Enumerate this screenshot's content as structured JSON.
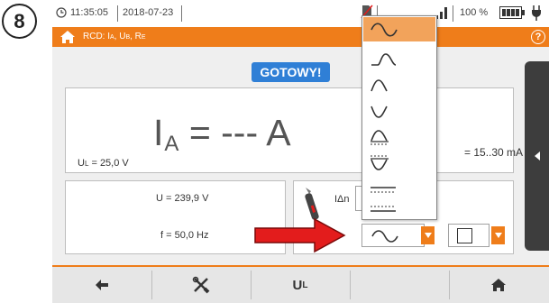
{
  "step_number": "8",
  "status": {
    "time": "11:35:05",
    "date": "2018-07-23",
    "battery_percent": "100 %",
    "icons": [
      "clock-icon",
      "sd-card-icon",
      "signal-bars-icon",
      "battery-icon",
      "plug-icon"
    ]
  },
  "titlebar": {
    "title": "RCD: I",
    "title_sub_a": "A",
    "title_mid": ", U",
    "title_sub_b": "B",
    "title_mid2": ", R",
    "title_sub_c": "E",
    "help": "?"
  },
  "main": {
    "ready_label": "GOTOWY!",
    "result_prefix": "I",
    "result_sub": "A",
    "result_value": " = --- A",
    "ul_prefix": "U",
    "ul_sub": "L",
    "ul_value": " = 25,0 V",
    "range_value": "= 15..30 mA",
    "voltage": "U = 239,9 V",
    "frequency": "f = 50,0 Hz",
    "idn_label": "IΔn"
  },
  "dropdown": {
    "items": [
      "sine",
      "positive-half-wave",
      "negative-half-wave",
      "positive-half-wave-dc-offset",
      "negative-half-wave-dc-offset",
      "dc-positive",
      "dc-negative"
    ],
    "selected_index": 0
  },
  "toolbar": {
    "ul_prefix": "U",
    "ul_sub": "L"
  },
  "colors": {
    "accent": "#ef7d1a",
    "ready_badge": "#2f7fd6",
    "arrow": "#e31c1c"
  }
}
